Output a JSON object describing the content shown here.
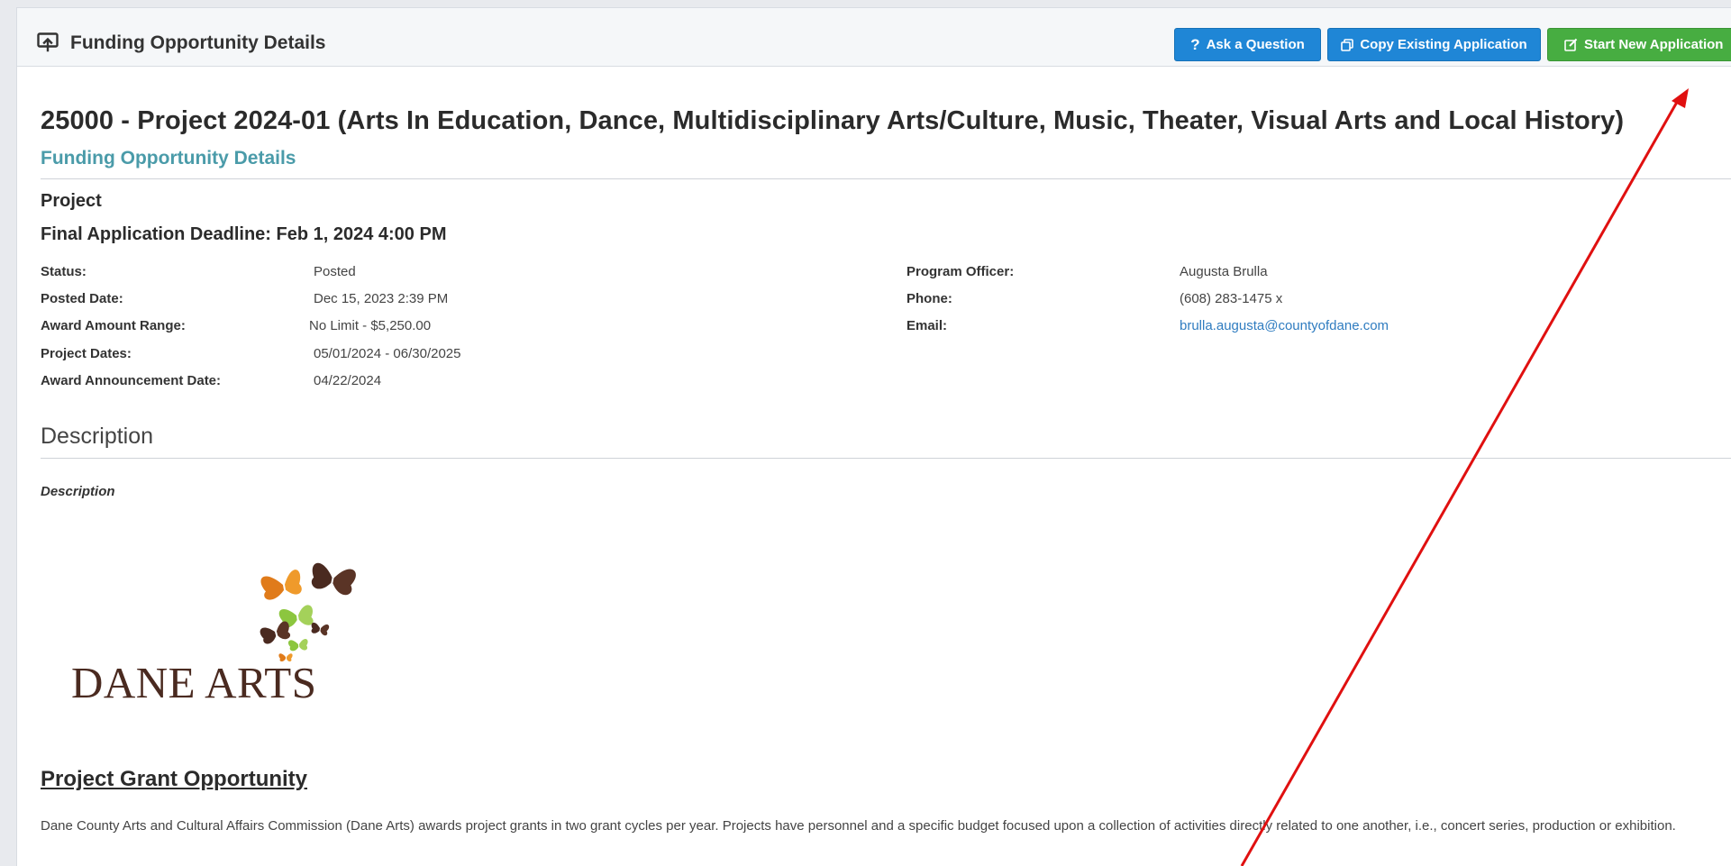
{
  "header": {
    "title": "Funding Opportunity Details",
    "buttons": {
      "ask": "Ask a Question",
      "copy": "Copy Existing Application",
      "start": "Start New Application"
    }
  },
  "opportunity": {
    "title": "25000 - Project 2024-01 (Arts In Education, Dance, Multidisciplinary Arts/Culture, Music, Theater, Visual Arts and Local History)",
    "subtitle": "Funding Opportunity Details",
    "section": "Project",
    "deadline": "Final Application Deadline: Feb 1, 2024 4:00 PM"
  },
  "fields_left": [
    {
      "label": "Status:",
      "value": "Posted"
    },
    {
      "label": "Posted Date:",
      "value": "Dec 15, 2023 2:39 PM"
    },
    {
      "label": "Award Amount Range:",
      "value": "No Limit - $5,250.00"
    },
    {
      "label": "Project Dates:",
      "value": "05/01/2024 - 06/30/2025"
    },
    {
      "label": "Award Announcement Date:",
      "value": "04/22/2024"
    }
  ],
  "fields_right": [
    {
      "label": "Program Officer:",
      "value": "Augusta Brulla"
    },
    {
      "label": "Phone:",
      "value": "(608) 283-1475 x"
    },
    {
      "label": "Email:",
      "value": "brulla.augusta@countyofdane.com"
    }
  ],
  "description": {
    "heading": "Description",
    "label": "Description",
    "logo_text": "DANE ARTS",
    "grant_heading": "Project Grant Opportunity",
    "paragraph": "Dane County Arts and Cultural Affairs Commission (Dane Arts) awards project grants in two grant cycles per year.  Projects have personnel and a specific budget focused upon a collection of activities directly related to one another, i.e., concert series, production or exhibition."
  },
  "colors": {
    "accent_blue": "#1f86d6",
    "accent_green": "#47ad41",
    "subtitle_teal": "#4a9ba9",
    "annotation_red": "#e01010"
  }
}
